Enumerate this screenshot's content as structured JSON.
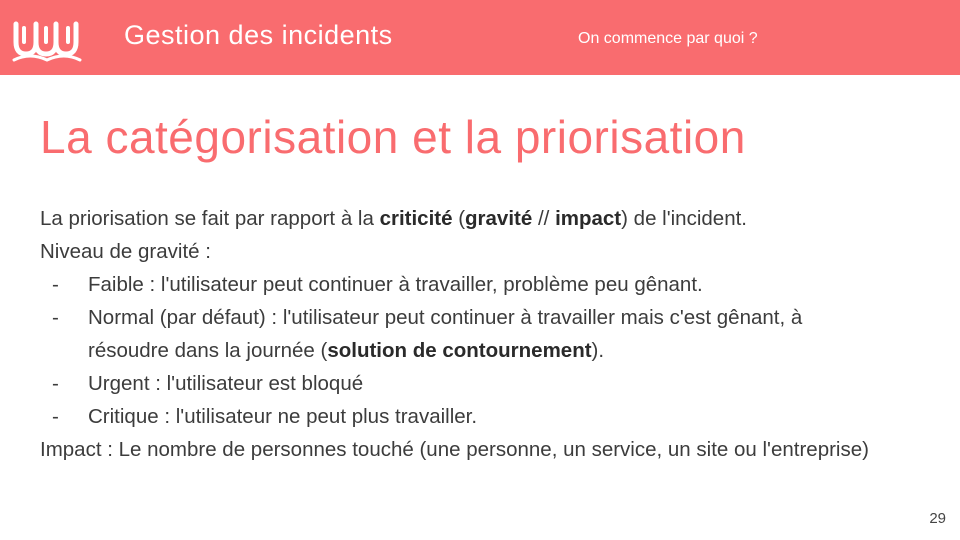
{
  "header": {
    "title": "Gestion des incidents",
    "subtitle": "On commence par quoi ?",
    "accent_color": "#f96c6f",
    "logo_icon": "wave-logo-icon"
  },
  "slide": {
    "title": "La catégorisation et la priorisation",
    "intro": {
      "a": "La priorisation se fait par rapport à la ",
      "b1": "criticité",
      "c": " (",
      "b2": "gravité",
      "d": " // ",
      "b3": "impact",
      "e": ") de l'incident."
    },
    "severity_heading": "Niveau de gravité :",
    "bullets": [
      {
        "dash": "-",
        "text": "Faible : l'utilisateur peut continuer à travailler, problème peu gênant."
      },
      {
        "dash": "-",
        "text": "Normal (par défaut) : l'utilisateur peut continuer à travailler mais c'est gênant, à résoudre dans la journée (",
        "bold": "solution de contournement",
        "after": ")."
      },
      {
        "dash": "-",
        "text": "Urgent : l'utilisateur est bloqué"
      },
      {
        "dash": "-",
        "text": "Critique : l'utilisateur ne peut plus travailler."
      }
    ],
    "impact": "Impact : Le nombre de personnes touché (une personne, un service, un site ou l'entreprise)"
  },
  "page_number": "29"
}
